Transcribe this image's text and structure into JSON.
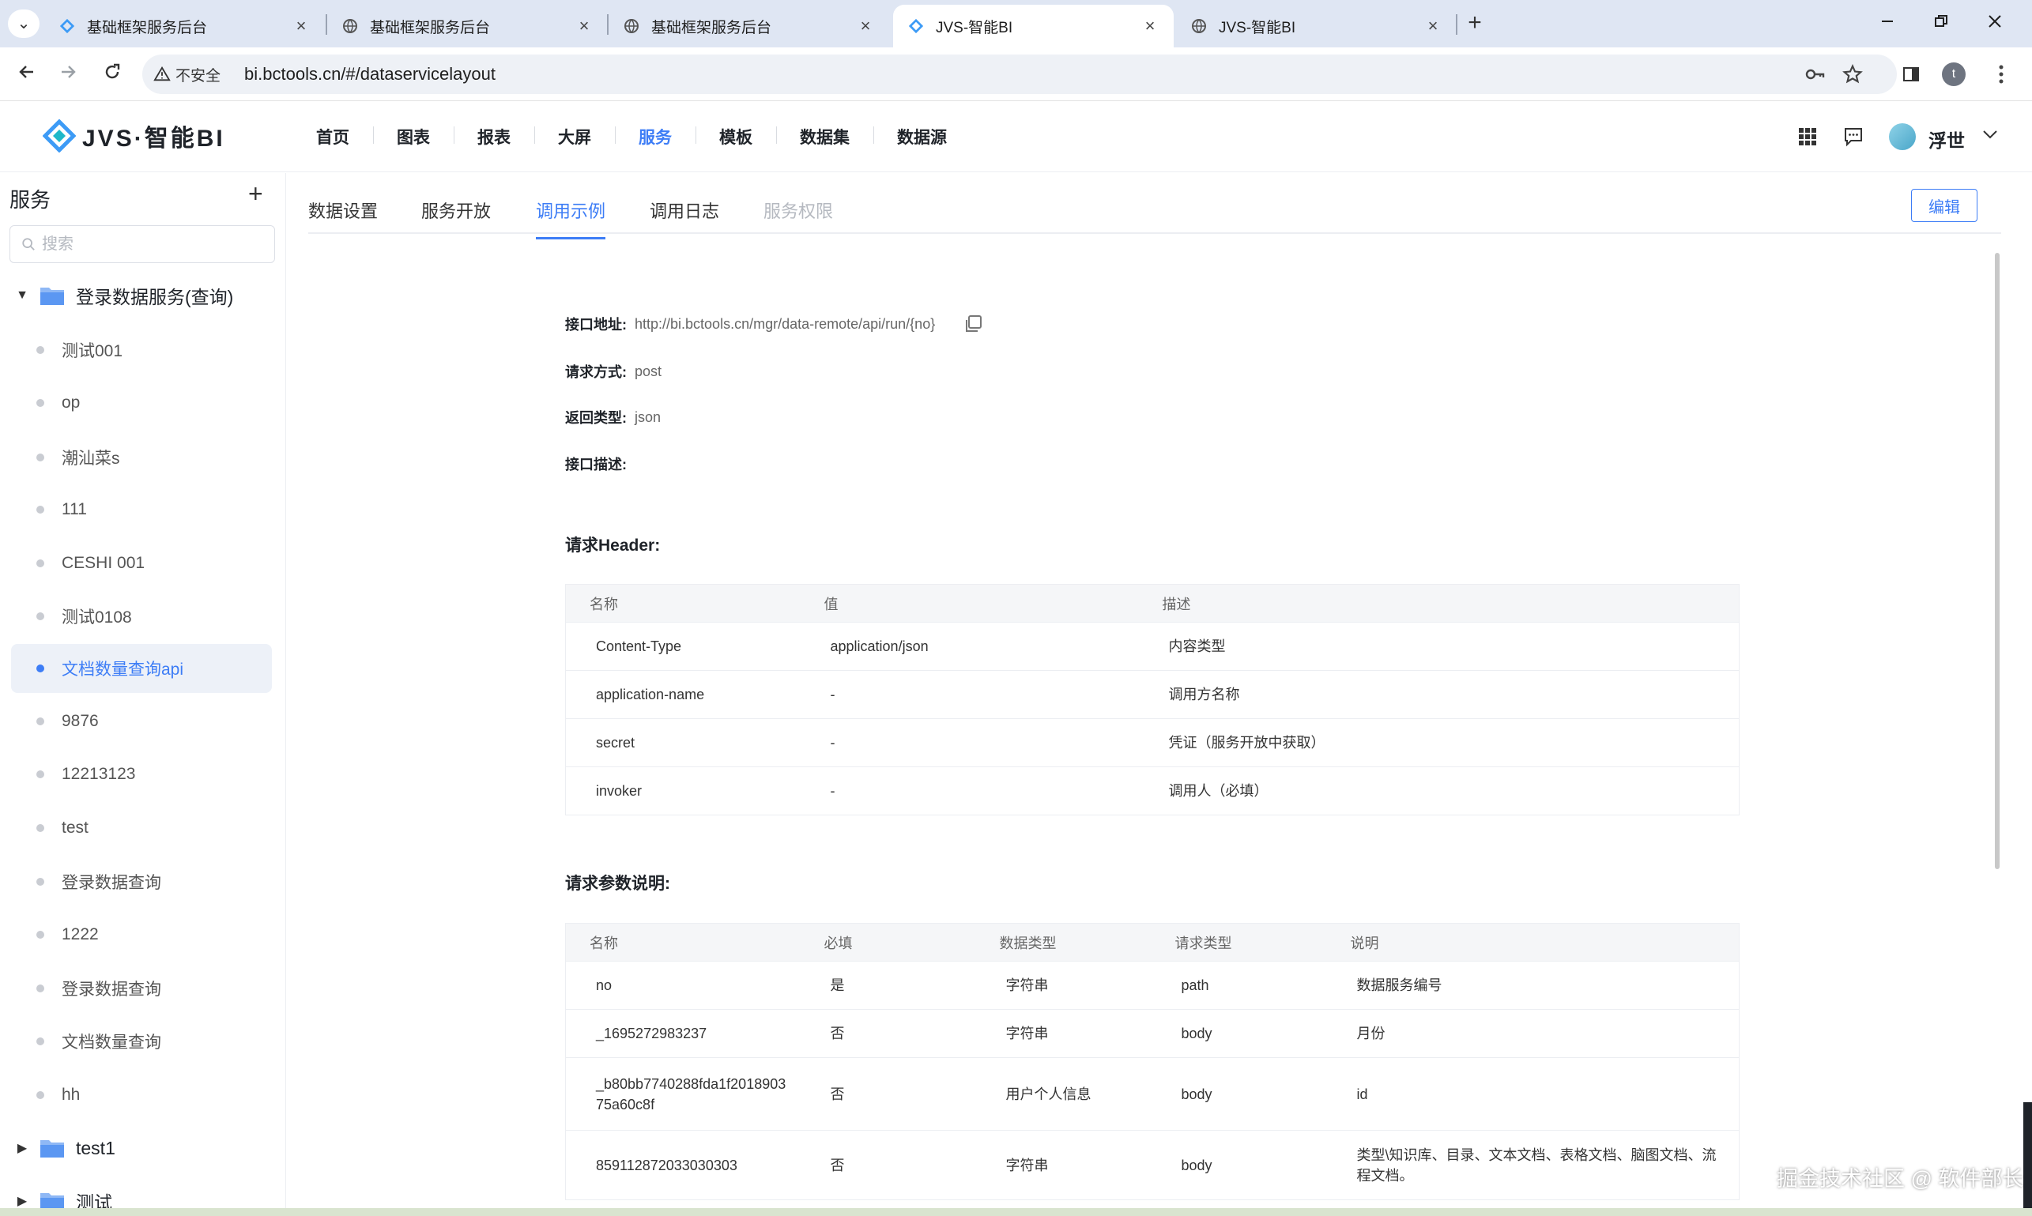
{
  "browser": {
    "tabs": [
      {
        "title": "基础框架服务后台",
        "icon": "jvs-logo-icon",
        "active": false
      },
      {
        "title": "基础框架服务后台",
        "icon": "globe-icon",
        "active": false
      },
      {
        "title": "基础框架服务后台",
        "icon": "globe-icon",
        "active": false
      },
      {
        "title": "JVS-智能BI",
        "icon": "jvs-logo-icon",
        "active": true
      },
      {
        "title": "JVS-智能BI",
        "icon": "globe-icon",
        "active": false
      }
    ],
    "security_label": "不安全",
    "url": "bi.bctools.cn/#/dataservicelayout",
    "profile_initial": "t"
  },
  "app": {
    "logo_text": "JVS·智能BI",
    "nav": [
      "首页",
      "图表",
      "报表",
      "大屏",
      "服务",
      "模板",
      "数据集",
      "数据源"
    ],
    "active_nav": "服务",
    "user_name": "浮世",
    "brand_color": "#3d7df6"
  },
  "sidebar": {
    "title": "服务",
    "search_placeholder": "搜索",
    "folders": [
      "登录数据服务(查询)",
      "test1",
      "测试"
    ],
    "items": [
      "测试001",
      "op",
      "潮汕菜s",
      "111",
      "CESHI 001",
      "测试0108",
      "文档数量查询api",
      "9876",
      "12213123",
      "test",
      "登录数据查询",
      "1222",
      "登录数据查询",
      "文档数量查询",
      "hh"
    ],
    "active_item": "文档数量查询api"
  },
  "content": {
    "tabs": [
      "数据设置",
      "服务开放",
      "调用示例",
      "调用日志",
      "服务权限"
    ],
    "active_tab": "调用示例",
    "edit_label": "编辑",
    "api": {
      "address_label": "接口地址:",
      "address": "http://bi.bctools.cn/mgr/data-remote/api/run/{no}",
      "method_label": "请求方式:",
      "method": "post",
      "return_label": "返回类型:",
      "return_type": "json",
      "desc_label": "接口描述:"
    },
    "header_section": {
      "title": "请求Header:",
      "columns": [
        "名称",
        "值",
        "描述"
      ],
      "rows": [
        [
          "Content-Type",
          "application/json",
          "内容类型"
        ],
        [
          "application-name",
          "-",
          "调用方名称"
        ],
        [
          "secret",
          "-",
          "凭证（服务开放中获取）"
        ],
        [
          "invoker",
          "-",
          "调用人（必填）"
        ]
      ]
    },
    "params_section": {
      "title": "请求参数说明:",
      "columns": [
        "名称",
        "必填",
        "数据类型",
        "请求类型",
        "说明"
      ],
      "rows": [
        [
          "no",
          "是",
          "字符串",
          "path",
          "数据服务编号"
        ],
        [
          "_1695272983237",
          "否",
          "字符串",
          "body",
          "月份"
        ],
        [
          "_b80bb7740288fda1f201890375a60c8f",
          "否",
          "用户个人信息",
          "body",
          "id"
        ],
        [
          "859112872033030303",
          "否",
          "字符串",
          "body",
          "类型\\知识库、目录、文本文档、表格文档、脑图文档、流程文档。"
        ]
      ]
    }
  },
  "watermark": "掘金技术社区 @ 软件部长"
}
